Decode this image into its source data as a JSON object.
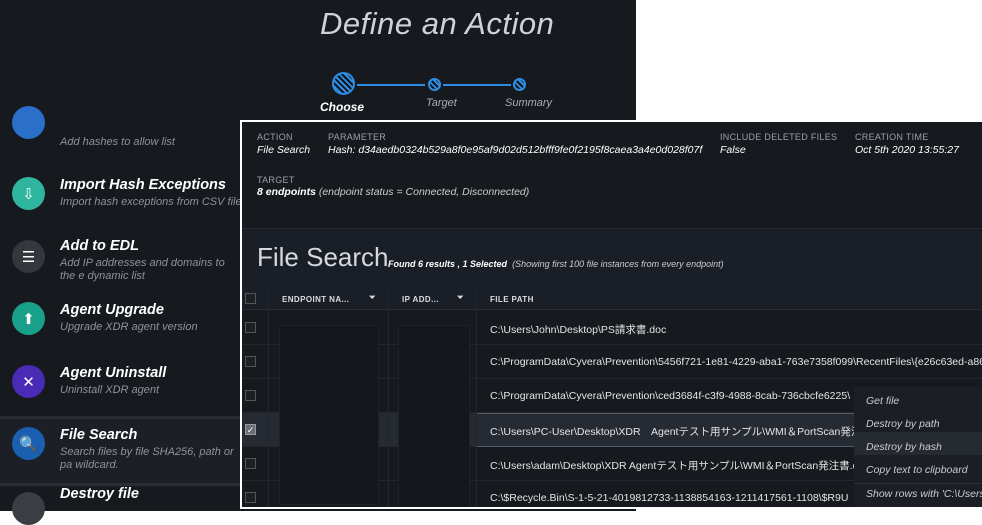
{
  "wizard": {
    "title": "Define an Action",
    "steps": [
      {
        "label": "Choose"
      },
      {
        "label": "Target"
      },
      {
        "label": "Summary"
      }
    ]
  },
  "actions": [
    {
      "name": "",
      "desc": "Add hashes to allow list",
      "icon": "allow-list-icon"
    },
    {
      "name": "Import Hash Exceptions",
      "desc": "Import hash exceptions from CSV file",
      "icon": "import-icon"
    },
    {
      "name": "Add to EDL",
      "desc": "Add IP addresses and domains to the e dynamic list",
      "icon": "list-icon"
    },
    {
      "name": "Agent Upgrade",
      "desc": "Upgrade XDR agent version",
      "icon": "upgrade-icon"
    },
    {
      "name": "Agent Uninstall",
      "desc": "Uninstall XDR agent",
      "icon": "uninstall-icon"
    },
    {
      "name": "File Search",
      "desc": "Search files by file SHA256, path or pa wildcard.",
      "icon": "file-search-icon"
    },
    {
      "name": "Destroy file",
      "desc": "",
      "icon": "destroy-file-icon"
    }
  ],
  "summary": {
    "action_label": "ACTION",
    "action": "File Search",
    "parameter_label": "PARAMETER",
    "parameter": "Hash: d34aedb0324b529a8f0e95af9d02d512bfff9fe0f2195f8caea3a4e0d028f07f",
    "deleted_label": "INCLUDE DELETED FILES",
    "deleted": "False",
    "time_label": "CREATION TIME",
    "time": "Oct 5th 2020 13:55:27",
    "target_label": "TARGET",
    "target_bold": "8 endpoints",
    "target_rest": " (endpoint status = Connected, Disconnected)"
  },
  "results": {
    "title": "File Search",
    "found": "Found 6 results , 1 Selected",
    "note": "(Showing first 100 file instances from every endpoint)",
    "columns": [
      "ENDPOINT NA...",
      "IP ADD...",
      "FILE PATH"
    ],
    "rows": [
      {
        "path": "C:\\Users\\John\\Desktop\\PS請求書.doc",
        "checked": false
      },
      {
        "path": "C:\\ProgramData\\Cyvera\\Prevention\\5456f721-1e81-4229-aba1-763e7358f099\\RecentFiles\\{e26c63ed-a86",
        "checked": false
      },
      {
        "path": "C:\\ProgramData\\Cyvera\\Prevention\\ced3684f-c3f9-4988-8cab-736cbcfe6225\\",
        "checked": false
      },
      {
        "path": "C:\\Users\\PC-User\\Desktop\\XDR　Agentテスト用サンプル\\WMI＆PortScan発注",
        "checked": true
      },
      {
        "path": "C:\\Users\\adam\\Desktop\\XDR Agentテスト用サンプル\\WMI＆PortScan発注書.do",
        "checked": false
      },
      {
        "path": "C:\\$Recycle.Bin\\S-1-5-21-4019812733-1138854163-1211417561-1108\\$R9U",
        "checked": false
      }
    ]
  },
  "context_menu": {
    "items": [
      "Get file",
      "Destroy by path",
      "Destroy by hash",
      "Copy text to clipboard",
      "Show rows with 'C:\\Users\\P"
    ]
  },
  "colors": {
    "accent": "#2f8de4",
    "bg": "#16191e"
  }
}
